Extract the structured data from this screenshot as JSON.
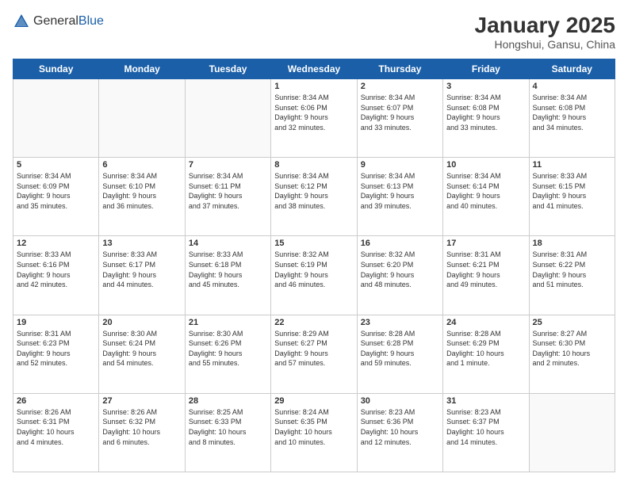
{
  "header": {
    "logo_general": "General",
    "logo_blue": "Blue",
    "month_title": "January 2025",
    "location": "Hongshui, Gansu, China"
  },
  "weekdays": [
    "Sunday",
    "Monday",
    "Tuesday",
    "Wednesday",
    "Thursday",
    "Friday",
    "Saturday"
  ],
  "weeks": [
    [
      {
        "day": "",
        "info": ""
      },
      {
        "day": "",
        "info": ""
      },
      {
        "day": "",
        "info": ""
      },
      {
        "day": "1",
        "info": "Sunrise: 8:34 AM\nSunset: 6:06 PM\nDaylight: 9 hours\nand 32 minutes."
      },
      {
        "day": "2",
        "info": "Sunrise: 8:34 AM\nSunset: 6:07 PM\nDaylight: 9 hours\nand 33 minutes."
      },
      {
        "day": "3",
        "info": "Sunrise: 8:34 AM\nSunset: 6:08 PM\nDaylight: 9 hours\nand 33 minutes."
      },
      {
        "day": "4",
        "info": "Sunrise: 8:34 AM\nSunset: 6:08 PM\nDaylight: 9 hours\nand 34 minutes."
      }
    ],
    [
      {
        "day": "5",
        "info": "Sunrise: 8:34 AM\nSunset: 6:09 PM\nDaylight: 9 hours\nand 35 minutes."
      },
      {
        "day": "6",
        "info": "Sunrise: 8:34 AM\nSunset: 6:10 PM\nDaylight: 9 hours\nand 36 minutes."
      },
      {
        "day": "7",
        "info": "Sunrise: 8:34 AM\nSunset: 6:11 PM\nDaylight: 9 hours\nand 37 minutes."
      },
      {
        "day": "8",
        "info": "Sunrise: 8:34 AM\nSunset: 6:12 PM\nDaylight: 9 hours\nand 38 minutes."
      },
      {
        "day": "9",
        "info": "Sunrise: 8:34 AM\nSunset: 6:13 PM\nDaylight: 9 hours\nand 39 minutes."
      },
      {
        "day": "10",
        "info": "Sunrise: 8:34 AM\nSunset: 6:14 PM\nDaylight: 9 hours\nand 40 minutes."
      },
      {
        "day": "11",
        "info": "Sunrise: 8:33 AM\nSunset: 6:15 PM\nDaylight: 9 hours\nand 41 minutes."
      }
    ],
    [
      {
        "day": "12",
        "info": "Sunrise: 8:33 AM\nSunset: 6:16 PM\nDaylight: 9 hours\nand 42 minutes."
      },
      {
        "day": "13",
        "info": "Sunrise: 8:33 AM\nSunset: 6:17 PM\nDaylight: 9 hours\nand 44 minutes."
      },
      {
        "day": "14",
        "info": "Sunrise: 8:33 AM\nSunset: 6:18 PM\nDaylight: 9 hours\nand 45 minutes."
      },
      {
        "day": "15",
        "info": "Sunrise: 8:32 AM\nSunset: 6:19 PM\nDaylight: 9 hours\nand 46 minutes."
      },
      {
        "day": "16",
        "info": "Sunrise: 8:32 AM\nSunset: 6:20 PM\nDaylight: 9 hours\nand 48 minutes."
      },
      {
        "day": "17",
        "info": "Sunrise: 8:31 AM\nSunset: 6:21 PM\nDaylight: 9 hours\nand 49 minutes."
      },
      {
        "day": "18",
        "info": "Sunrise: 8:31 AM\nSunset: 6:22 PM\nDaylight: 9 hours\nand 51 minutes."
      }
    ],
    [
      {
        "day": "19",
        "info": "Sunrise: 8:31 AM\nSunset: 6:23 PM\nDaylight: 9 hours\nand 52 minutes."
      },
      {
        "day": "20",
        "info": "Sunrise: 8:30 AM\nSunset: 6:24 PM\nDaylight: 9 hours\nand 54 minutes."
      },
      {
        "day": "21",
        "info": "Sunrise: 8:30 AM\nSunset: 6:26 PM\nDaylight: 9 hours\nand 55 minutes."
      },
      {
        "day": "22",
        "info": "Sunrise: 8:29 AM\nSunset: 6:27 PM\nDaylight: 9 hours\nand 57 minutes."
      },
      {
        "day": "23",
        "info": "Sunrise: 8:28 AM\nSunset: 6:28 PM\nDaylight: 9 hours\nand 59 minutes."
      },
      {
        "day": "24",
        "info": "Sunrise: 8:28 AM\nSunset: 6:29 PM\nDaylight: 10 hours\nand 1 minute."
      },
      {
        "day": "25",
        "info": "Sunrise: 8:27 AM\nSunset: 6:30 PM\nDaylight: 10 hours\nand 2 minutes."
      }
    ],
    [
      {
        "day": "26",
        "info": "Sunrise: 8:26 AM\nSunset: 6:31 PM\nDaylight: 10 hours\nand 4 minutes."
      },
      {
        "day": "27",
        "info": "Sunrise: 8:26 AM\nSunset: 6:32 PM\nDaylight: 10 hours\nand 6 minutes."
      },
      {
        "day": "28",
        "info": "Sunrise: 8:25 AM\nSunset: 6:33 PM\nDaylight: 10 hours\nand 8 minutes."
      },
      {
        "day": "29",
        "info": "Sunrise: 8:24 AM\nSunset: 6:35 PM\nDaylight: 10 hours\nand 10 minutes."
      },
      {
        "day": "30",
        "info": "Sunrise: 8:23 AM\nSunset: 6:36 PM\nDaylight: 10 hours\nand 12 minutes."
      },
      {
        "day": "31",
        "info": "Sunrise: 8:23 AM\nSunset: 6:37 PM\nDaylight: 10 hours\nand 14 minutes."
      },
      {
        "day": "",
        "info": ""
      }
    ]
  ]
}
